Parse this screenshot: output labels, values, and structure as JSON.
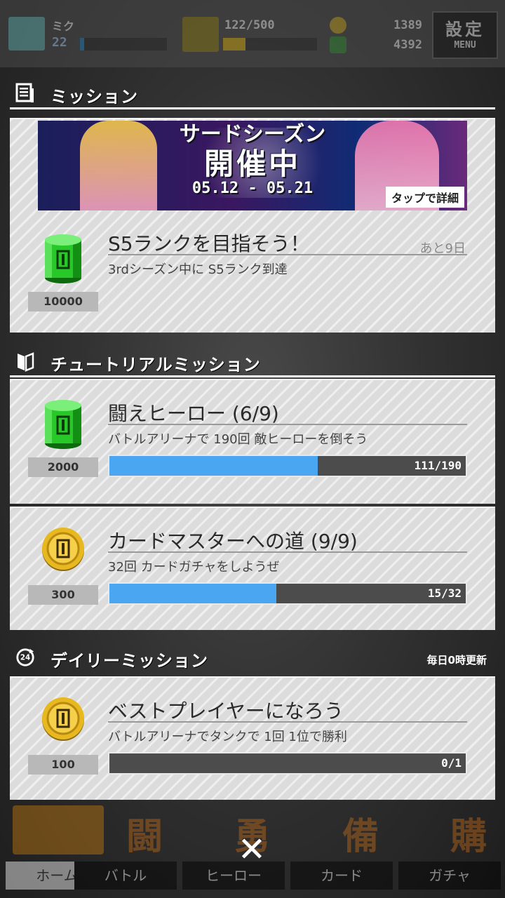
{
  "topbar": {
    "player_name": "ミク",
    "level": "22",
    "rank_xp": "122/500",
    "currency_coin": "1389",
    "currency_gem": "4392",
    "menu_kanji": "設定",
    "menu_label": "MENU",
    "xp_fraction": 0.05,
    "rank_fraction": 0.24
  },
  "mission_section": {
    "title": "ミッション"
  },
  "banner": {
    "title_top": "サードシーズン",
    "title_main": "開催中",
    "dates": "05.12 - 05.21",
    "tap_label": "タップで詳細"
  },
  "season_mission": {
    "title": "S5ランクを目指そう！",
    "remaining": "あと9日",
    "description": "3rdシーズン中に S5ランク到達",
    "reward_amount": "10000",
    "reward_icon": "green-can-icon"
  },
  "tutorial_section": {
    "title": "チュートリアルミッション"
  },
  "tutorial_missions": [
    {
      "title": "闘えヒーロー (6/9)",
      "description": "バトルアリーナで 190回 敵ヒーローを倒そう",
      "reward_amount": "2000",
      "reward_icon": "green-can-icon",
      "progress_text": "111/190",
      "progress_fraction": 0.584
    },
    {
      "title": "カードマスターへの道 (9/9)",
      "description": "32回 カードガチャをしようぜ",
      "reward_amount": "300",
      "reward_icon": "gold-coin-icon",
      "progress_text": "15/32",
      "progress_fraction": 0.469
    }
  ],
  "daily_section": {
    "title": "デイリーミッション",
    "refresh_note": "毎日0時更新",
    "icon_label": "24"
  },
  "daily_missions": [
    {
      "title": "ベストプレイヤーになろう",
      "description": "バトルアリーナでタンクで 1回 1位で勝利",
      "reward_amount": "100",
      "reward_icon": "gold-coin-icon",
      "progress_text": "0/1",
      "progress_fraction": 0
    }
  ],
  "nav": {
    "home": "ホーム",
    "battle": "バトル",
    "battle_kanji": "闘",
    "hero": "ヒーロー",
    "hero_kanji": "勇",
    "card": "カード",
    "card_kanji": "備",
    "gacha": "ガチャ",
    "gacha_kanji": "購"
  },
  "close_symbol": "✕",
  "colors": {
    "progress_fill": "#4aa6f0",
    "card_bg": "#dcdcdc",
    "green_can": "#28c828",
    "gold_coin": "#e8b820"
  }
}
